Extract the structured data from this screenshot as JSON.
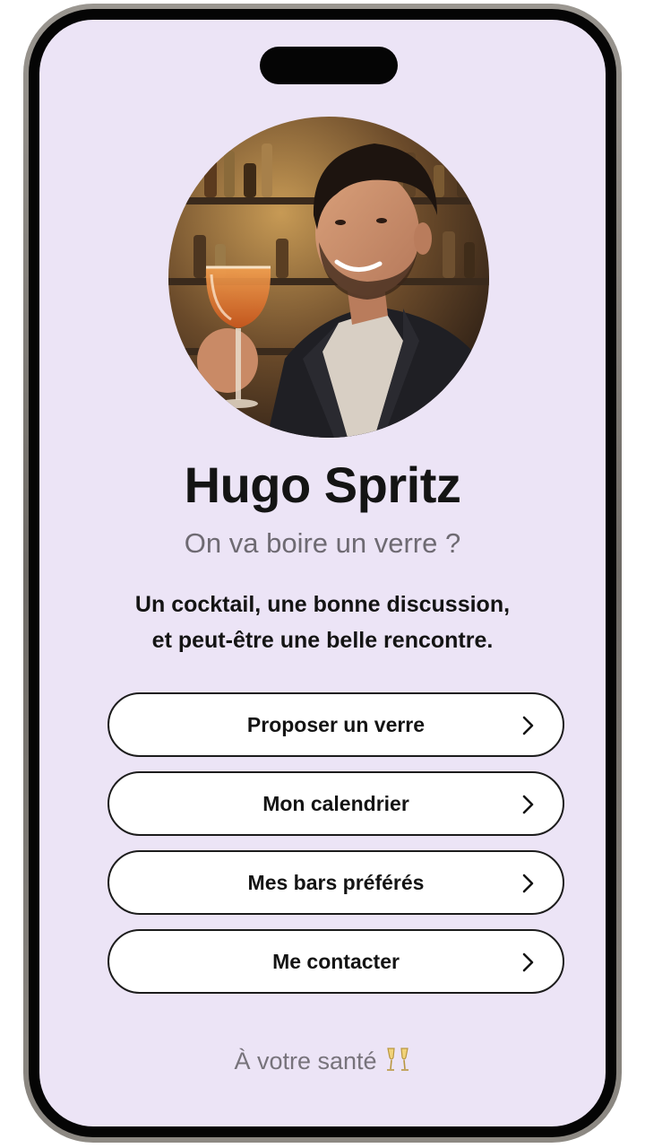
{
  "profile": {
    "name": "Hugo Spritz",
    "tagline": "On va boire un verre ?",
    "description_lines": [
      "Un cocktail, une bonne discussion,",
      "et peut-être une belle rencontre."
    ],
    "avatar_icon": "profile-photo-man-with-spritz"
  },
  "menu": {
    "items": [
      {
        "label": "Proposer un verre",
        "icon": "chevron-right-icon"
      },
      {
        "label": "Mon calendrier",
        "icon": "chevron-right-icon"
      },
      {
        "label": "Mes bars préférés",
        "icon": "chevron-right-icon"
      },
      {
        "label": "Me contacter",
        "icon": "chevron-right-icon"
      }
    ]
  },
  "footer": {
    "text": "À votre santé",
    "icon": "clinking-glasses-icon"
  },
  "colors": {
    "background": "#ece4f6",
    "button_background": "#ffffff",
    "button_border": "#1c1c1c",
    "text_primary": "#141414",
    "text_secondary": "#6e6a72"
  }
}
